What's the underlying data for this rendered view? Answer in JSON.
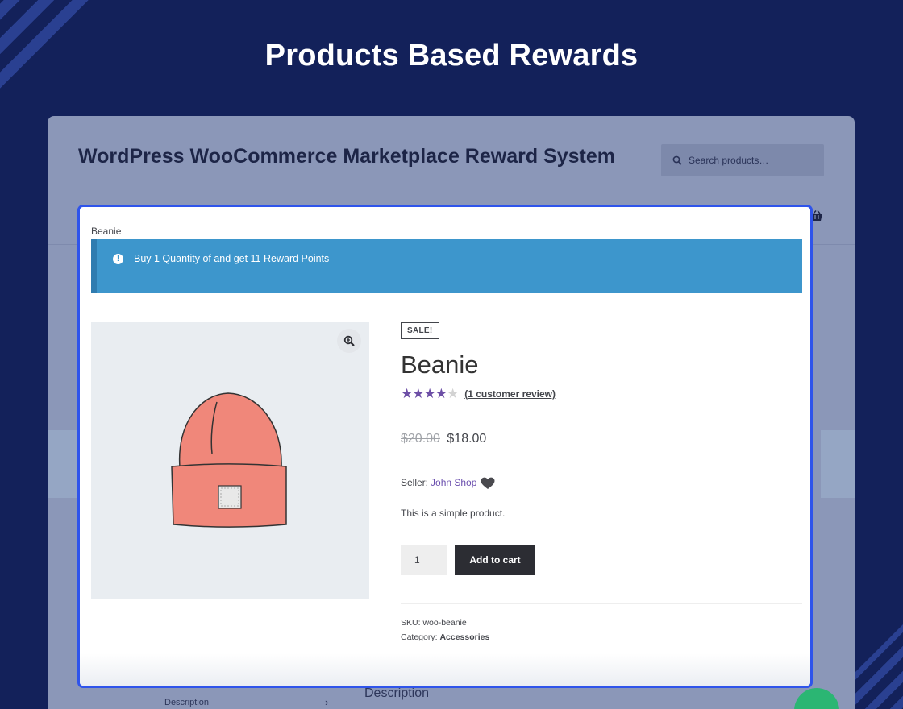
{
  "hero": {
    "title": "Products Based Rewards"
  },
  "shop": {
    "site_title": "WordPress WooCommerce Marketplace Reward System",
    "search_placeholder": "Search products…",
    "bg_tab_description": "Description",
    "bg_description_heading": "Description"
  },
  "modal": {
    "breadcrumb": "Beanie",
    "notice": "Buy 1 Quantity of and get 11 Reward Points",
    "product": {
      "sale_badge": "SALE!",
      "name": "Beanie",
      "rating_value": 4,
      "rating_max": 5,
      "review_link": "(1 customer review)",
      "price_old": "$20.00",
      "price_new": "$18.00",
      "seller_label": "Seller:",
      "seller_name": "John Shop",
      "short_description": "This is a simple product.",
      "quantity": "1",
      "add_to_cart": "Add to cart",
      "sku_label": "SKU:",
      "sku": "woo-beanie",
      "category_label": "Category:",
      "category": "Accessories"
    }
  },
  "colors": {
    "background": "#13215a",
    "notice": "#3d96cc",
    "modal_border": "#2f54eb",
    "star": "#6d4fa6",
    "button": "#2c2d33"
  },
  "icons": [
    "search-icon",
    "cart-icon",
    "info-icon",
    "zoom-icon",
    "heart-icon",
    "chevron-right-icon",
    "chat-icon"
  ]
}
